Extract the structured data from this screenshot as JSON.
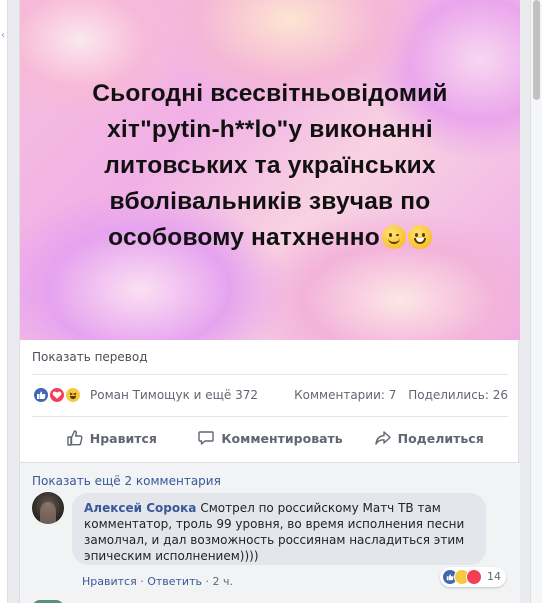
{
  "post": {
    "banner_text": "Сьогодні всесвітньовідомий хіт\"pytin-h**lo\"у виконанні литовських та українських вболівальників звучав по особовому натхненно",
    "banner_emojis": [
      "wink-face-icon",
      "grinning-face-icon"
    ],
    "translate_link": "Показать перевод"
  },
  "reactions": {
    "icons": [
      "like-icon",
      "love-icon",
      "haha-icon"
    ],
    "summary": "Роман Тимощук и ещё 372",
    "comments": "Комментарии: 7",
    "shares": "Поделились: 26"
  },
  "actions": {
    "like": "Нравится",
    "comment": "Комментировать",
    "share": "Поделиться"
  },
  "comments": {
    "show_more": "Показать ещё 2 комментария",
    "items": [
      {
        "author": "Алексей Сорока",
        "text": "Смотрел по российскому Матч ТВ там комментатор, троль 99 уровня, во время исполнения песни замолчал, и дал возможность россиянам насладиться этим эпическим исполнением))))",
        "like_link": "Нравится",
        "reply_link": "Ответить",
        "time": "2 ч.",
        "reaction_count": "14"
      }
    ]
  },
  "colors": {
    "link": "#385898",
    "like_blue": "#4267b2",
    "love_red": "#f33e58",
    "haha_yellow": "#f7c940",
    "secondary_text": "#606770"
  }
}
